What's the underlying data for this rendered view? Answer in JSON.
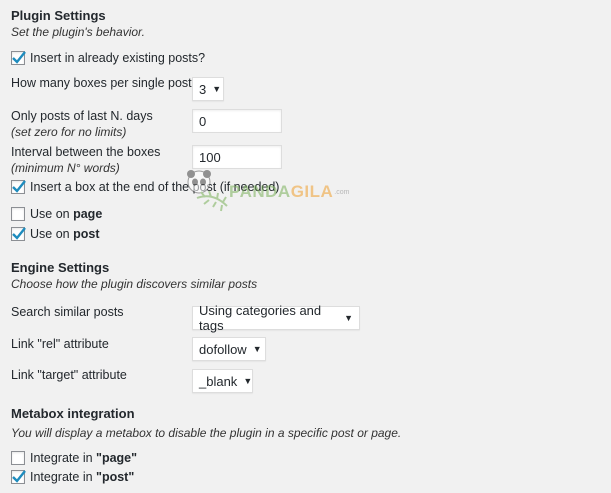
{
  "plugin_settings": {
    "title": "Plugin Settings",
    "description": "Set the plugin's behavior.",
    "insert_existing": {
      "label": "Insert in already existing posts?",
      "checked": true
    },
    "boxes_per_post": {
      "label": "How many boxes per single post?",
      "value": "3"
    },
    "last_n_days": {
      "label": "Only posts of last N. days",
      "sub": "(set zero for no limits)",
      "value": "0"
    },
    "interval": {
      "label": "Interval between the boxes",
      "sub": "(minimum N° words)",
      "value": "100"
    },
    "box_end": {
      "label": "Insert a box at the end of the post (if needed)",
      "checked": true
    },
    "use_on_page": {
      "prefix": "Use on ",
      "bold": "page",
      "checked": false
    },
    "use_on_post": {
      "prefix": "Use on ",
      "bold": "post",
      "checked": true
    }
  },
  "engine_settings": {
    "title": "Engine Settings",
    "description": "Choose how the plugin discovers similar posts",
    "search_similar": {
      "label": "Search similar posts",
      "value": "Using categories and tags"
    },
    "link_rel": {
      "label": "Link \"rel\" attribute",
      "value": "dofollow"
    },
    "link_target": {
      "label": "Link \"target\" attribute",
      "value": "_blank"
    }
  },
  "metabox": {
    "title": "Metabox integration",
    "description": "You will display a metabox to disable the plugin in a specific post or page.",
    "integrate_page": {
      "prefix": "Integrate in ",
      "bold": "\"page\"",
      "checked": false
    },
    "integrate_post": {
      "prefix": "Integrate in ",
      "bold": "\"post\"",
      "checked": true
    }
  },
  "watermark": {
    "part1": "PANDA",
    "part2": "GILA",
    "suffix": ".com",
    "icon": "panda-icon"
  },
  "colors": {
    "check": "#1e8cbe",
    "background": "#f1f1f1",
    "field_border": "#dddddd"
  }
}
